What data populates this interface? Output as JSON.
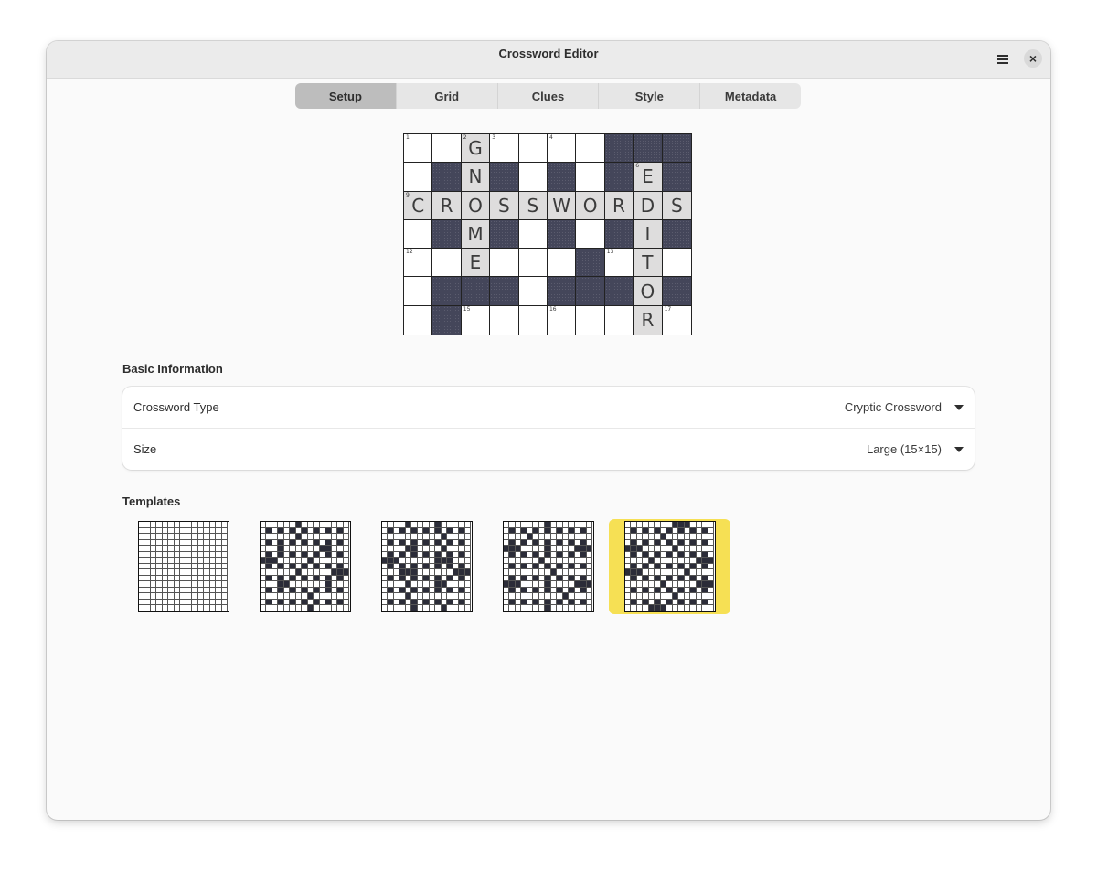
{
  "window": {
    "title": "Crossword Editor"
  },
  "header": {
    "menu_icon": "hamburger-menu-icon",
    "close_icon": "close-icon",
    "close_glyph": "×"
  },
  "tabs": [
    {
      "label": "Setup",
      "active": true
    },
    {
      "label": "Grid",
      "active": false
    },
    {
      "label": "Clues",
      "active": false
    },
    {
      "label": "Style",
      "active": false
    },
    {
      "label": "Metadata",
      "active": false
    }
  ],
  "preview_grid": {
    "rows": [
      [
        "1:",
        ":",
        "2:G",
        "3:",
        ":",
        "4:",
        ":",
        "#",
        "#",
        "#"
      ],
      [
        ":",
        "#",
        ":N",
        "#",
        ":",
        "#",
        ":",
        "#",
        "6:E",
        "#"
      ],
      [
        "9:C",
        ":R",
        ":O",
        ":S",
        ":S",
        ":W",
        ":O",
        ":R",
        ":D",
        ":S"
      ],
      [
        ":",
        "#",
        ":M",
        "#",
        ":",
        "#",
        ":",
        "#",
        ":I",
        "#"
      ],
      [
        "12:",
        ":",
        ":E",
        ":",
        ":",
        ":",
        "#",
        "13:",
        ":T",
        ":"
      ],
      [
        ":",
        "#",
        "#",
        "#",
        ":",
        "#",
        "#",
        "#",
        ":O",
        "#"
      ],
      [
        ":",
        "#",
        "15:",
        ":",
        ":",
        "16:",
        ":",
        ":",
        ":R",
        "17:"
      ]
    ],
    "highlighted_letters": [
      "G",
      "N",
      "C",
      "R",
      "O",
      "S",
      "S",
      "W",
      "O",
      "R",
      "D",
      "S",
      "M",
      "E",
      "E",
      "I",
      "T",
      "O",
      "R"
    ]
  },
  "basic_information": {
    "heading": "Basic Information",
    "crossword_type": {
      "label": "Crossword Type",
      "value": "Cryptic Crossword"
    },
    "size": {
      "label": "Size",
      "value": "Large (15×15)"
    }
  },
  "templates": {
    "heading": "Templates",
    "selected_index": 4,
    "items": [
      {
        "name": "blank",
        "pattern": [
          "...............",
          "...............",
          "...............",
          "...............",
          "...............",
          "...............",
          "...............",
          "...............",
          "...............",
          "...............",
          "...............",
          "...............",
          "...............",
          "...............",
          "..............."
        ]
      },
      {
        "name": "template-2",
        "pattern": [
          "......#........",
          ".#.#.#.#.#.#.#.",
          "......#........",
          ".#.#.#.#.#.#.#.",
          "...#......##...",
          ".#.#.#.#.#.#.#.",
          "###.....#......",
          ".#.#.#.#.#.#.#.",
          "......#.....###",
          ".#.#.#.#.#.#.#.",
          "...##......#...",
          ".#.#.#.#.#.#.#.",
          "........#......",
          ".#.#.#.#.#.#.#.",
          "........#......"
        ]
      },
      {
        "name": "template-3",
        "pattern": [
          "....#....#.....",
          ".#.#.#.#.#.#.#.",
          "..........#....",
          ".#.#.#.#.#.#.#.",
          "....##....#....",
          ".#.#.#.#.#.#.#.",
          "###......###...",
          ".#.#.#.#.#.#.#.",
          "...###......###",
          ".#.#.#.#.#.#.#.",
          "....#....##....",
          ".#.#.#.#.#.#.#.",
          "....#..........",
          ".#.#.#.#.#.#.#.",
          ".....#....#...."
        ]
      },
      {
        "name": "template-4",
        "pattern": [
          ".......#.......",
          ".#.#.#.#.#.#.#.",
          "....#..........",
          ".#.#.#.#.#.#.#.",
          "###....#....###",
          ".#.#.#.#.#.#.#.",
          "......#........",
          ".#.#.#.#.#.#.#.",
          "........#......",
          ".#.#.#.#.#.#.#.",
          "###....#....###",
          ".#.#.#.#.#.#.#.",
          "..........#....",
          ".#.#.#.#.#.#.#.",
          ".......#......."
        ]
      },
      {
        "name": "template-5",
        "pattern": [
          "........###....",
          ".#.#.#.#.#.#.#.",
          "......#........",
          ".#.#.#.#.#.#.#.",
          "###.....#......",
          ".#.#.#.#.#.#.#.",
          "....#.......###",
          ".#.#.#.#.#.#.#.",
          "###.......#....",
          ".#.#.#.#.#.#.#.",
          "......#.....###",
          ".#.#.#.#.#.#.#.",
          "........#......",
          ".#.#.#.#.#.#.#.",
          "....###........"
        ]
      }
    ]
  }
}
